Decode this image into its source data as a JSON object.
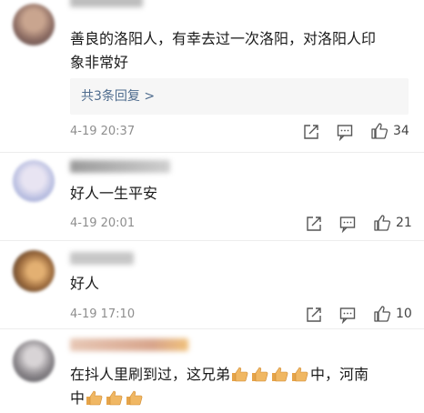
{
  "comments": [
    {
      "text": "善良的洛阳人，有幸去过一次洛阳，对洛阳人印",
      "text2": "象非常好",
      "replies_label": "共3条回复 >",
      "time": "4-19 20:37",
      "likes": "34"
    },
    {
      "text": "好人一生平安",
      "time": "4-19 20:01",
      "likes": "21"
    },
    {
      "text": "好人",
      "time": "4-19 17:10",
      "likes": "10"
    },
    {
      "text_a": "在抖人里刷到过，这兄弟",
      "text_b": "中，河南",
      "text2": "中"
    }
  ],
  "icons": {
    "share": "share-icon",
    "comment": "comment-icon",
    "like": "thumbs-up-icon",
    "emoji": "thumbs-up-emoji"
  },
  "colors": {
    "link": "#4f6c8e",
    "meta": "#8e8e8e",
    "emoji": "#f0b763"
  }
}
